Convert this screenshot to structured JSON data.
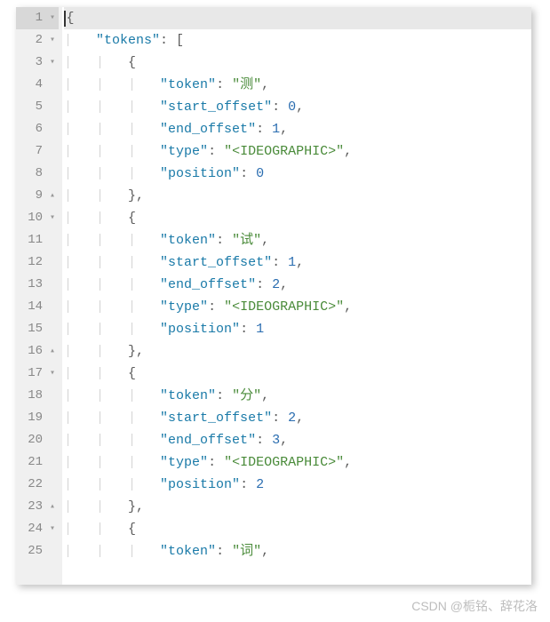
{
  "currentLine": 1,
  "lines": [
    {
      "n": 1,
      "fold": "▾",
      "indent": 0,
      "segs": [
        {
          "t": "cursor"
        },
        {
          "t": "punct",
          "v": "{"
        }
      ]
    },
    {
      "n": 2,
      "fold": "▾",
      "indent": 1,
      "segs": [
        {
          "t": "key",
          "v": "\"tokens\""
        },
        {
          "t": "punct",
          "v": ": ["
        }
      ]
    },
    {
      "n": 3,
      "fold": "▾",
      "indent": 2,
      "segs": [
        {
          "t": "punct",
          "v": "{"
        }
      ]
    },
    {
      "n": 4,
      "fold": "",
      "indent": 3,
      "segs": [
        {
          "t": "key",
          "v": "\"token\""
        },
        {
          "t": "punct",
          "v": ": "
        },
        {
          "t": "str",
          "v": "\"测\""
        },
        {
          "t": "punct",
          "v": ","
        }
      ]
    },
    {
      "n": 5,
      "fold": "",
      "indent": 3,
      "segs": [
        {
          "t": "key",
          "v": "\"start_offset\""
        },
        {
          "t": "punct",
          "v": ": "
        },
        {
          "t": "num",
          "v": "0"
        },
        {
          "t": "punct",
          "v": ","
        }
      ]
    },
    {
      "n": 6,
      "fold": "",
      "indent": 3,
      "segs": [
        {
          "t": "key",
          "v": "\"end_offset\""
        },
        {
          "t": "punct",
          "v": ": "
        },
        {
          "t": "num",
          "v": "1"
        },
        {
          "t": "punct",
          "v": ","
        }
      ]
    },
    {
      "n": 7,
      "fold": "",
      "indent": 3,
      "segs": [
        {
          "t": "key",
          "v": "\"type\""
        },
        {
          "t": "punct",
          "v": ": "
        },
        {
          "t": "str",
          "v": "\"<IDEOGRAPHIC>\""
        },
        {
          "t": "punct",
          "v": ","
        }
      ]
    },
    {
      "n": 8,
      "fold": "",
      "indent": 3,
      "segs": [
        {
          "t": "key",
          "v": "\"position\""
        },
        {
          "t": "punct",
          "v": ": "
        },
        {
          "t": "num",
          "v": "0"
        }
      ]
    },
    {
      "n": 9,
      "fold": "▴",
      "indent": 2,
      "segs": [
        {
          "t": "punct",
          "v": "},"
        }
      ]
    },
    {
      "n": 10,
      "fold": "▾",
      "indent": 2,
      "segs": [
        {
          "t": "punct",
          "v": "{"
        }
      ]
    },
    {
      "n": 11,
      "fold": "",
      "indent": 3,
      "segs": [
        {
          "t": "key",
          "v": "\"token\""
        },
        {
          "t": "punct",
          "v": ": "
        },
        {
          "t": "str",
          "v": "\"试\""
        },
        {
          "t": "punct",
          "v": ","
        }
      ]
    },
    {
      "n": 12,
      "fold": "",
      "indent": 3,
      "segs": [
        {
          "t": "key",
          "v": "\"start_offset\""
        },
        {
          "t": "punct",
          "v": ": "
        },
        {
          "t": "num",
          "v": "1"
        },
        {
          "t": "punct",
          "v": ","
        }
      ]
    },
    {
      "n": 13,
      "fold": "",
      "indent": 3,
      "segs": [
        {
          "t": "key",
          "v": "\"end_offset\""
        },
        {
          "t": "punct",
          "v": ": "
        },
        {
          "t": "num",
          "v": "2"
        },
        {
          "t": "punct",
          "v": ","
        }
      ]
    },
    {
      "n": 14,
      "fold": "",
      "indent": 3,
      "segs": [
        {
          "t": "key",
          "v": "\"type\""
        },
        {
          "t": "punct",
          "v": ": "
        },
        {
          "t": "str",
          "v": "\"<IDEOGRAPHIC>\""
        },
        {
          "t": "punct",
          "v": ","
        }
      ]
    },
    {
      "n": 15,
      "fold": "",
      "indent": 3,
      "segs": [
        {
          "t": "key",
          "v": "\"position\""
        },
        {
          "t": "punct",
          "v": ": "
        },
        {
          "t": "num",
          "v": "1"
        }
      ]
    },
    {
      "n": 16,
      "fold": "▴",
      "indent": 2,
      "segs": [
        {
          "t": "punct",
          "v": "},"
        }
      ]
    },
    {
      "n": 17,
      "fold": "▾",
      "indent": 2,
      "segs": [
        {
          "t": "punct",
          "v": "{"
        }
      ]
    },
    {
      "n": 18,
      "fold": "",
      "indent": 3,
      "segs": [
        {
          "t": "key",
          "v": "\"token\""
        },
        {
          "t": "punct",
          "v": ": "
        },
        {
          "t": "str",
          "v": "\"分\""
        },
        {
          "t": "punct",
          "v": ","
        }
      ]
    },
    {
      "n": 19,
      "fold": "",
      "indent": 3,
      "segs": [
        {
          "t": "key",
          "v": "\"start_offset\""
        },
        {
          "t": "punct",
          "v": ": "
        },
        {
          "t": "num",
          "v": "2"
        },
        {
          "t": "punct",
          "v": ","
        }
      ]
    },
    {
      "n": 20,
      "fold": "",
      "indent": 3,
      "segs": [
        {
          "t": "key",
          "v": "\"end_offset\""
        },
        {
          "t": "punct",
          "v": ": "
        },
        {
          "t": "num",
          "v": "3"
        },
        {
          "t": "punct",
          "v": ","
        }
      ]
    },
    {
      "n": 21,
      "fold": "",
      "indent": 3,
      "segs": [
        {
          "t": "key",
          "v": "\"type\""
        },
        {
          "t": "punct",
          "v": ": "
        },
        {
          "t": "str",
          "v": "\"<IDEOGRAPHIC>\""
        },
        {
          "t": "punct",
          "v": ","
        }
      ]
    },
    {
      "n": 22,
      "fold": "",
      "indent": 3,
      "segs": [
        {
          "t": "key",
          "v": "\"position\""
        },
        {
          "t": "punct",
          "v": ": "
        },
        {
          "t": "num",
          "v": "2"
        }
      ]
    },
    {
      "n": 23,
      "fold": "▴",
      "indent": 2,
      "segs": [
        {
          "t": "punct",
          "v": "},"
        }
      ]
    },
    {
      "n": 24,
      "fold": "▾",
      "indent": 2,
      "segs": [
        {
          "t": "punct",
          "v": "{"
        }
      ]
    },
    {
      "n": 25,
      "fold": "",
      "indent": 3,
      "segs": [
        {
          "t": "key",
          "v": "\"token\""
        },
        {
          "t": "punct",
          "v": ": "
        },
        {
          "t": "str",
          "v": "\"词\""
        },
        {
          "t": "punct",
          "v": ","
        }
      ]
    }
  ],
  "watermark": "CSDN @栀铭、辞花洛"
}
